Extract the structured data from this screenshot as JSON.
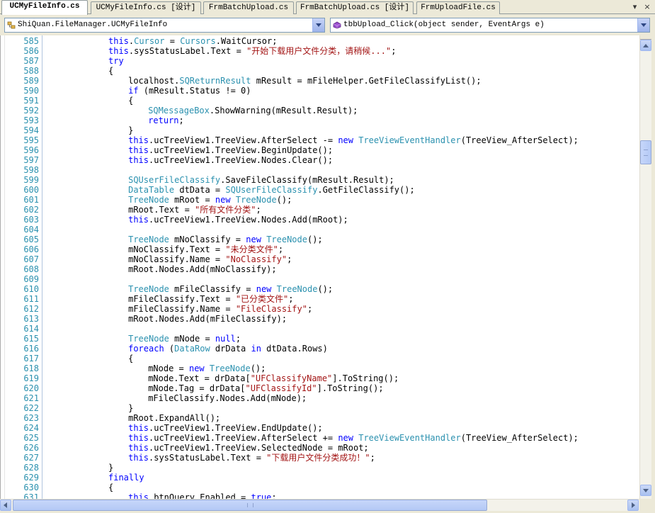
{
  "tabs": [
    {
      "label": "UCMyFileInfo.cs",
      "active": true
    },
    {
      "label": "UCMyFileInfo.cs [设计]",
      "active": false
    },
    {
      "label": "FrmBatchUpload.cs",
      "active": false
    },
    {
      "label": "FrmBatchUpload.cs [设计]",
      "active": false
    },
    {
      "label": "FrmUploadFile.cs",
      "active": false
    }
  ],
  "tab_tools": {
    "dropdown": "▾",
    "close": "×"
  },
  "nav": {
    "type_combo": "ShiQuan.FileManager.UCMyFileInfo",
    "member_combo": "tbbUpload_Click(object sender, EventArgs e)"
  },
  "colors": {
    "keyword": "#0000ff",
    "type": "#2b91af",
    "string": "#a31515",
    "line_number": "#2b91af"
  },
  "code": [
    {
      "n": "585",
      "i": 2,
      "t": [
        [
          "kw",
          "this"
        ],
        [
          "pl",
          "."
        ],
        [
          "ty",
          "Cursor"
        ],
        [
          "pl",
          " = "
        ],
        [
          "ty",
          "Cursors"
        ],
        [
          "pl",
          ".WaitCursor;"
        ]
      ]
    },
    {
      "n": "586",
      "i": 2,
      "t": [
        [
          "kw",
          "this"
        ],
        [
          "pl",
          ".sysStatusLabel.Text = "
        ],
        [
          "st",
          "\"开始下载用户文件分类，请稍候...\""
        ],
        [
          "pl",
          ";"
        ]
      ]
    },
    {
      "n": "587",
      "i": 2,
      "t": [
        [
          "kw",
          "try"
        ]
      ]
    },
    {
      "n": "588",
      "i": 2,
      "t": [
        [
          "pl",
          "{"
        ]
      ]
    },
    {
      "n": "589",
      "i": 3,
      "t": [
        [
          "pl",
          "localhost."
        ],
        [
          "ty",
          "SQReturnResult"
        ],
        [
          "pl",
          " mResult = mFileHelper.GetFileClassifyList();"
        ]
      ]
    },
    {
      "n": "590",
      "i": 3,
      "t": [
        [
          "kw",
          "if"
        ],
        [
          "pl",
          " (mResult.Status != 0)"
        ]
      ]
    },
    {
      "n": "591",
      "i": 3,
      "t": [
        [
          "pl",
          "{"
        ]
      ]
    },
    {
      "n": "592",
      "i": 4,
      "t": [
        [
          "ty",
          "SQMessageBox"
        ],
        [
          "pl",
          ".ShowWarning(mResult.Result);"
        ]
      ]
    },
    {
      "n": "593",
      "i": 4,
      "t": [
        [
          "kw",
          "return"
        ],
        [
          "pl",
          ";"
        ]
      ]
    },
    {
      "n": "594",
      "i": 3,
      "t": [
        [
          "pl",
          "}"
        ]
      ]
    },
    {
      "n": "595",
      "i": 3,
      "t": [
        [
          "kw",
          "this"
        ],
        [
          "pl",
          ".ucTreeView1.TreeView.AfterSelect -= "
        ],
        [
          "kw",
          "new"
        ],
        [
          "pl",
          " "
        ],
        [
          "ty",
          "TreeViewEventHandler"
        ],
        [
          "pl",
          "(TreeView_AfterSelect);"
        ]
      ]
    },
    {
      "n": "596",
      "i": 3,
      "t": [
        [
          "kw",
          "this"
        ],
        [
          "pl",
          ".ucTreeView1.TreeView.BeginUpdate();"
        ]
      ]
    },
    {
      "n": "597",
      "i": 3,
      "t": [
        [
          "kw",
          "this"
        ],
        [
          "pl",
          ".ucTreeView1.TreeView.Nodes.Clear();"
        ]
      ]
    },
    {
      "n": "598",
      "i": 0,
      "t": []
    },
    {
      "n": "599",
      "i": 3,
      "t": [
        [
          "ty",
          "SQUserFileClassify"
        ],
        [
          "pl",
          ".SaveFileClassify(mResult.Result);"
        ]
      ]
    },
    {
      "n": "600",
      "i": 3,
      "t": [
        [
          "ty",
          "DataTable"
        ],
        [
          "pl",
          " dtData = "
        ],
        [
          "ty",
          "SQUserFileClassify"
        ],
        [
          "pl",
          ".GetFileClassify();"
        ]
      ]
    },
    {
      "n": "601",
      "i": 3,
      "t": [
        [
          "ty",
          "TreeNode"
        ],
        [
          "pl",
          " mRoot = "
        ],
        [
          "kw",
          "new"
        ],
        [
          "pl",
          " "
        ],
        [
          "ty",
          "TreeNode"
        ],
        [
          "pl",
          "();"
        ]
      ]
    },
    {
      "n": "602",
      "i": 3,
      "t": [
        [
          "pl",
          "mRoot.Text = "
        ],
        [
          "st",
          "\"所有文件分类\""
        ],
        [
          "pl",
          ";"
        ]
      ]
    },
    {
      "n": "603",
      "i": 3,
      "t": [
        [
          "kw",
          "this"
        ],
        [
          "pl",
          ".ucTreeView1.TreeView.Nodes.Add(mRoot);"
        ]
      ]
    },
    {
      "n": "604",
      "i": 0,
      "t": []
    },
    {
      "n": "605",
      "i": 3,
      "t": [
        [
          "ty",
          "TreeNode"
        ],
        [
          "pl",
          " mNoClassify = "
        ],
        [
          "kw",
          "new"
        ],
        [
          "pl",
          " "
        ],
        [
          "ty",
          "TreeNode"
        ],
        [
          "pl",
          "();"
        ]
      ]
    },
    {
      "n": "606",
      "i": 3,
      "t": [
        [
          "pl",
          "mNoClassify.Text = "
        ],
        [
          "st",
          "\"未分类文件\""
        ],
        [
          "pl",
          ";"
        ]
      ]
    },
    {
      "n": "607",
      "i": 3,
      "t": [
        [
          "pl",
          "mNoClassify.Name = "
        ],
        [
          "st",
          "\"NoClassify\""
        ],
        [
          "pl",
          ";"
        ]
      ]
    },
    {
      "n": "608",
      "i": 3,
      "t": [
        [
          "pl",
          "mRoot.Nodes.Add(mNoClassify);"
        ]
      ]
    },
    {
      "n": "609",
      "i": 0,
      "t": []
    },
    {
      "n": "610",
      "i": 3,
      "t": [
        [
          "ty",
          "TreeNode"
        ],
        [
          "pl",
          " mFileClassify = "
        ],
        [
          "kw",
          "new"
        ],
        [
          "pl",
          " "
        ],
        [
          "ty",
          "TreeNode"
        ],
        [
          "pl",
          "();"
        ]
      ]
    },
    {
      "n": "611",
      "i": 3,
      "t": [
        [
          "pl",
          "mFileClassify.Text = "
        ],
        [
          "st",
          "\"已分类文件\""
        ],
        [
          "pl",
          ";"
        ]
      ]
    },
    {
      "n": "612",
      "i": 3,
      "t": [
        [
          "pl",
          "mFileClassify.Name = "
        ],
        [
          "st",
          "\"FileClassify\""
        ],
        [
          "pl",
          ";"
        ]
      ]
    },
    {
      "n": "613",
      "i": 3,
      "t": [
        [
          "pl",
          "mRoot.Nodes.Add(mFileClassify);"
        ]
      ]
    },
    {
      "n": "614",
      "i": 0,
      "t": []
    },
    {
      "n": "615",
      "i": 3,
      "t": [
        [
          "ty",
          "TreeNode"
        ],
        [
          "pl",
          " mNode = "
        ],
        [
          "kw",
          "null"
        ],
        [
          "pl",
          ";"
        ]
      ]
    },
    {
      "n": "616",
      "i": 3,
      "t": [
        [
          "kw",
          "foreach"
        ],
        [
          "pl",
          " ("
        ],
        [
          "ty",
          "DataRow"
        ],
        [
          "pl",
          " drData "
        ],
        [
          "kw",
          "in"
        ],
        [
          "pl",
          " dtData.Rows)"
        ]
      ]
    },
    {
      "n": "617",
      "i": 3,
      "t": [
        [
          "pl",
          "{"
        ]
      ]
    },
    {
      "n": "618",
      "i": 4,
      "t": [
        [
          "pl",
          "mNode = "
        ],
        [
          "kw",
          "new"
        ],
        [
          "pl",
          " "
        ],
        [
          "ty",
          "TreeNode"
        ],
        [
          "pl",
          "();"
        ]
      ]
    },
    {
      "n": "619",
      "i": 4,
      "t": [
        [
          "pl",
          "mNode.Text = drData["
        ],
        [
          "st",
          "\"UFClassifyName\""
        ],
        [
          "pl",
          "].ToString();"
        ]
      ]
    },
    {
      "n": "620",
      "i": 4,
      "t": [
        [
          "pl",
          "mNode.Tag = drData["
        ],
        [
          "st",
          "\"UFClassifyId\""
        ],
        [
          "pl",
          "].ToString();"
        ]
      ]
    },
    {
      "n": "621",
      "i": 4,
      "t": [
        [
          "pl",
          "mFileClassify.Nodes.Add(mNode);"
        ]
      ]
    },
    {
      "n": "622",
      "i": 3,
      "t": [
        [
          "pl",
          "}"
        ]
      ]
    },
    {
      "n": "623",
      "i": 3,
      "t": [
        [
          "pl",
          "mRoot.ExpandAll();"
        ]
      ]
    },
    {
      "n": "624",
      "i": 3,
      "t": [
        [
          "kw",
          "this"
        ],
        [
          "pl",
          ".ucTreeView1.TreeView.EndUpdate();"
        ]
      ]
    },
    {
      "n": "625",
      "i": 3,
      "t": [
        [
          "kw",
          "this"
        ],
        [
          "pl",
          ".ucTreeView1.TreeView.AfterSelect += "
        ],
        [
          "kw",
          "new"
        ],
        [
          "pl",
          " "
        ],
        [
          "ty",
          "TreeViewEventHandler"
        ],
        [
          "pl",
          "(TreeView_AfterSelect);"
        ]
      ]
    },
    {
      "n": "626",
      "i": 3,
      "t": [
        [
          "kw",
          "this"
        ],
        [
          "pl",
          ".ucTreeView1.TreeView.SelectedNode = mRoot;"
        ]
      ]
    },
    {
      "n": "627",
      "i": 3,
      "t": [
        [
          "kw",
          "this"
        ],
        [
          "pl",
          ".sysStatusLabel.Text = "
        ],
        [
          "st",
          "\"下载用户文件分类成功！\""
        ],
        [
          "pl",
          ";"
        ]
      ]
    },
    {
      "n": "628",
      "i": 2,
      "t": [
        [
          "pl",
          "}"
        ]
      ]
    },
    {
      "n": "629",
      "i": 2,
      "t": [
        [
          "kw",
          "finally"
        ]
      ]
    },
    {
      "n": "630",
      "i": 2,
      "t": [
        [
          "pl",
          "{"
        ]
      ]
    },
    {
      "n": "631",
      "i": 3,
      "t": [
        [
          "kw",
          "this"
        ],
        [
          "pl",
          ".btnQuery.Enabled = "
        ],
        [
          "kw",
          "true"
        ],
        [
          "pl",
          ";"
        ]
      ]
    }
  ]
}
